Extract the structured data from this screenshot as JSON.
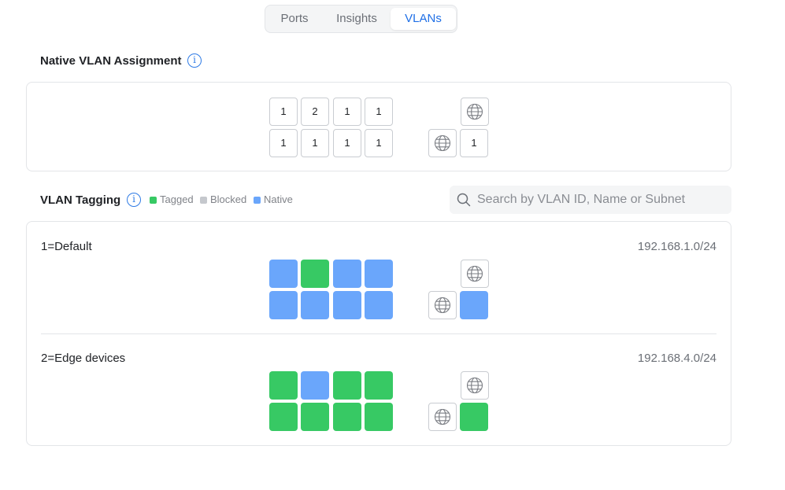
{
  "tabs": [
    {
      "label": "Ports",
      "active": false
    },
    {
      "label": "Insights",
      "active": false
    },
    {
      "label": "VLANs",
      "active": true
    }
  ],
  "native_section": {
    "title": "Native VLAN Assignment",
    "top_row": [
      "1",
      "2",
      "1",
      "1"
    ],
    "bottom_row": [
      "1",
      "1",
      "1",
      "1"
    ],
    "uplink_value": "1"
  },
  "tagging_section": {
    "title": "VLAN Tagging",
    "legend": [
      {
        "label": "Tagged",
        "color": "#37c964"
      },
      {
        "label": "Blocked",
        "color": "#c5c8cd"
      },
      {
        "label": "Native",
        "color": "#6aa6fb"
      }
    ],
    "search_placeholder": "Search by VLAN ID, Name or Subnet"
  },
  "status_colors": {
    "tagged": "#37c964",
    "blocked": "#c5c8cd",
    "native": "#6aa6fb"
  },
  "vlans": [
    {
      "name": "1=Default",
      "subnet": "192.168.1.0/24",
      "top_row": [
        "native",
        "tagged",
        "native",
        "native"
      ],
      "bottom_row": [
        "native",
        "native",
        "native",
        "native"
      ],
      "uplink": "native"
    },
    {
      "name": "2=Edge devices",
      "subnet": "192.168.4.0/24",
      "top_row": [
        "tagged",
        "native",
        "tagged",
        "tagged"
      ],
      "bottom_row": [
        "tagged",
        "tagged",
        "tagged",
        "tagged"
      ],
      "uplink": "tagged"
    }
  ],
  "icons": {
    "info": "info-icon",
    "globe": "globe-icon",
    "search": "search-icon"
  }
}
